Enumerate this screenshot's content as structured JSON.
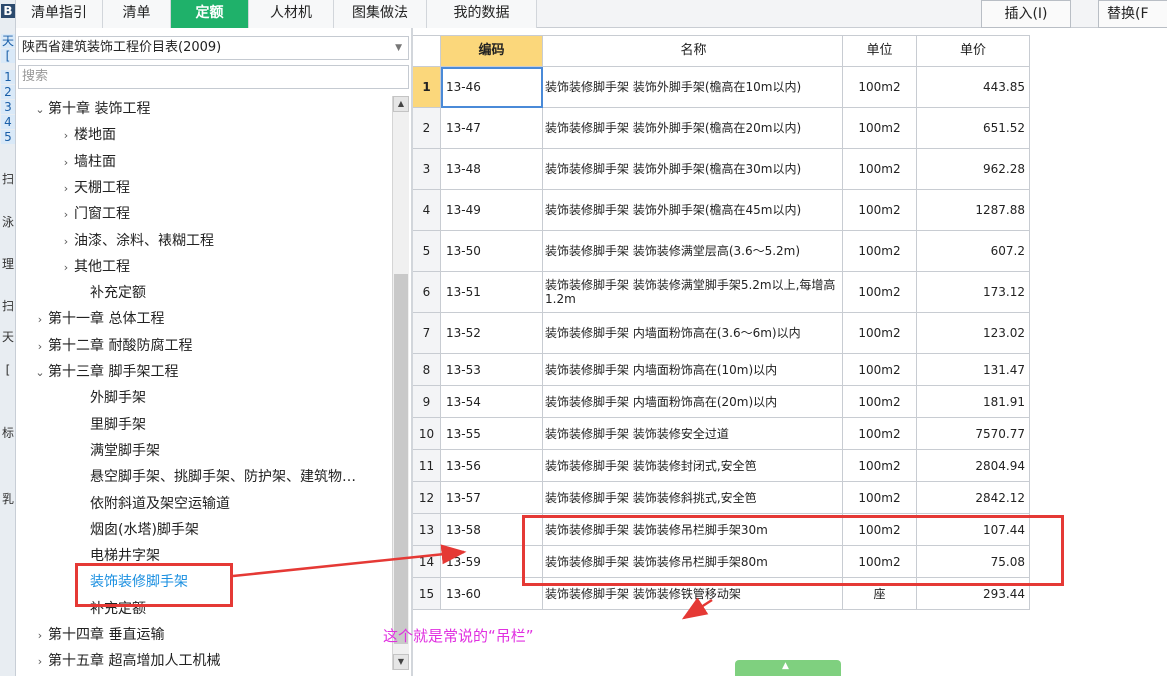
{
  "left_strip": {
    "header": "B",
    "items": [
      "天",
      "[",
      "1",
      "2",
      "3",
      "4",
      "5",
      "扫",
      "泳",
      "理",
      "扫",
      "天",
      "[",
      "标",
      "乳"
    ]
  },
  "tabs": [
    {
      "label": "清单指引"
    },
    {
      "label": "清单"
    },
    {
      "label": "定额"
    },
    {
      "label": "人材机"
    },
    {
      "label": "图集做法"
    },
    {
      "label": "我的数据"
    }
  ],
  "toolbar": {
    "insert_label": "插入(I)",
    "replace_label": "替换(F"
  },
  "library_select": {
    "value": "陕西省建筑装饰工程价目表(2009)"
  },
  "search": {
    "placeholder": "搜索"
  },
  "tree": [
    {
      "caret": "⌄",
      "label": "第十章 装饰工程"
    },
    {
      "caret": "›",
      "label": "楼地面"
    },
    {
      "caret": "›",
      "label": "墙柱面"
    },
    {
      "caret": "›",
      "label": "天棚工程"
    },
    {
      "caret": "›",
      "label": "门窗工程"
    },
    {
      "caret": "›",
      "label": "油漆、涂料、裱糊工程"
    },
    {
      "caret": "›",
      "label": "其他工程"
    },
    {
      "caret": "",
      "label": "补充定额"
    },
    {
      "caret": "›",
      "label": "第十一章 总体工程"
    },
    {
      "caret": "›",
      "label": "第十二章 耐酸防腐工程"
    },
    {
      "caret": "⌄",
      "label": "第十三章 脚手架工程"
    },
    {
      "caret": "",
      "label": "外脚手架"
    },
    {
      "caret": "",
      "label": "里脚手架"
    },
    {
      "caret": "",
      "label": "满堂脚手架"
    },
    {
      "caret": "",
      "label": "悬空脚手架、挑脚手架、防护架、建筑物…"
    },
    {
      "caret": "",
      "label": "依附斜道及架空运输道"
    },
    {
      "caret": "",
      "label": "烟囱(水塔)脚手架"
    },
    {
      "caret": "",
      "label": "电梯井字架"
    },
    {
      "caret": "",
      "label": "装饰装修脚手架"
    },
    {
      "caret": "",
      "label": "补充定额"
    },
    {
      "caret": "›",
      "label": "第十四章 垂直运输"
    },
    {
      "caret": "›",
      "label": "第十五章 超高增加人工机械"
    }
  ],
  "table": {
    "headers": {
      "num": "",
      "code": "编码",
      "name": "名称",
      "unit": "单位",
      "price": "单价"
    },
    "rows": [
      {
        "num": "1",
        "code": "13-46",
        "name": "装饰装修脚手架 装饰外脚手架(檐高在10m以内)",
        "unit": "100m2",
        "price": "443.85"
      },
      {
        "num": "2",
        "code": "13-47",
        "name": "装饰装修脚手架 装饰外脚手架(檐高在20m以内)",
        "unit": "100m2",
        "price": "651.52"
      },
      {
        "num": "3",
        "code": "13-48",
        "name": "装饰装修脚手架 装饰外脚手架(檐高在30m以内)",
        "unit": "100m2",
        "price": "962.28"
      },
      {
        "num": "4",
        "code": "13-49",
        "name": "装饰装修脚手架 装饰外脚手架(檐高在45m以内)",
        "unit": "100m2",
        "price": "1287.88"
      },
      {
        "num": "5",
        "code": "13-50",
        "name": "装饰装修脚手架 装饰装修满堂层高(3.6～5.2m)",
        "unit": "100m2",
        "price": "607.2"
      },
      {
        "num": "6",
        "code": "13-51",
        "name": "装饰装修脚手架 装饰装修满堂脚手架5.2m以上,每增高1.2m",
        "unit": "100m2",
        "price": "173.12"
      },
      {
        "num": "7",
        "code": "13-52",
        "name": "装饰装修脚手架 内墙面粉饰高在(3.6～6m)以内",
        "unit": "100m2",
        "price": "123.02"
      },
      {
        "num": "8",
        "code": "13-53",
        "name": "装饰装修脚手架 内墙面粉饰高在(10m)以内",
        "unit": "100m2",
        "price": "131.47"
      },
      {
        "num": "9",
        "code": "13-54",
        "name": "装饰装修脚手架 内墙面粉饰高在(20m)以内",
        "unit": "100m2",
        "price": "181.91"
      },
      {
        "num": "10",
        "code": "13-55",
        "name": "装饰装修脚手架 装饰装修安全过道",
        "unit": "100m2",
        "price": "7570.77"
      },
      {
        "num": "11",
        "code": "13-56",
        "name": "装饰装修脚手架 装饰装修封闭式,安全笆",
        "unit": "100m2",
        "price": "2804.94"
      },
      {
        "num": "12",
        "code": "13-57",
        "name": "装饰装修脚手架 装饰装修斜挑式,安全笆",
        "unit": "100m2",
        "price": "2842.12"
      },
      {
        "num": "13",
        "code": "13-58",
        "name": "装饰装修脚手架 装饰装修吊栏脚手架30m",
        "unit": "100m2",
        "price": "107.44"
      },
      {
        "num": "14",
        "code": "13-59",
        "name": "装饰装修脚手架 装饰装修吊栏脚手架80m",
        "unit": "100m2",
        "price": "75.08"
      },
      {
        "num": "15",
        "code": "13-60",
        "name": "装饰装修脚手架 装饰装修铁管移动架",
        "unit": "座",
        "price": "293.44"
      }
    ]
  },
  "annotation": {
    "text": "这个就是常说的“吊栏”"
  },
  "colors": {
    "active_tab": "#1fb16a",
    "header_highlight": "#fbd77b",
    "annotation_red": "#e53935",
    "annotation_text": "#e030e0",
    "selected_tree": "#1a8fe0"
  }
}
